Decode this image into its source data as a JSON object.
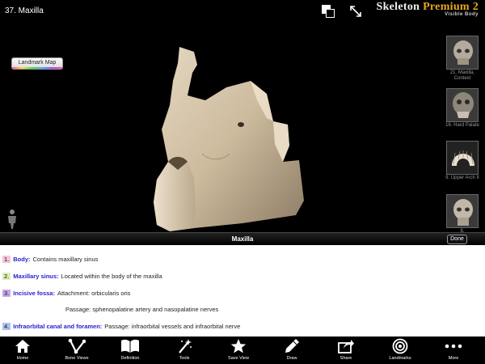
{
  "header": {
    "view_title": "37. Maxilla",
    "brand_word1": "Skeleton",
    "brand_word2": "Premium 2",
    "brand_sub": "Visible Body"
  },
  "viewport": {
    "landmark_map_label": "Landmark Map",
    "thumbnails": [
      {
        "label": "21. Maxilla, Context"
      },
      {
        "label": "16. Hard Palate"
      },
      {
        "label": "9. Upper Arch II"
      },
      {
        "label": "8."
      }
    ]
  },
  "info": {
    "title": "Maxilla",
    "done_label": "Done",
    "items": [
      {
        "num": "1.",
        "term": "Body:",
        "desc": "Contains maxillary sinus",
        "color": "#f6c6d9"
      },
      {
        "num": "2.",
        "term": "Maxillary sinus:",
        "desc": "Located within the body of the maxilla",
        "color": "#d9efb6"
      },
      {
        "num": "3.",
        "term": "Incisive fossa:",
        "desc": "Attachment: orbicularis oris",
        "color": "#c6a7e6"
      },
      {
        "num": "4.",
        "term": "Infraorbital canal and foramen:",
        "desc": "Passage: infraorbital vessels and infraorbital nerve",
        "color": "#a9c4ee"
      }
    ],
    "incisive_passage": "Passage: sphenopalatine artery and nasopalatine nerves"
  },
  "toolbar": {
    "items": [
      {
        "label": "Home",
        "icon": "home-icon"
      },
      {
        "label": "Bone Views",
        "icon": "bone-views-icon"
      },
      {
        "label": "Definition",
        "icon": "book-icon"
      },
      {
        "label": "Tools",
        "icon": "magic-wand-icon"
      },
      {
        "label": "Save View",
        "icon": "star-icon"
      },
      {
        "label": "Draw",
        "icon": "pencil-icon"
      },
      {
        "label": "Share",
        "icon": "share-icon"
      },
      {
        "label": "Landmarks",
        "icon": "target-icon"
      },
      {
        "label": "More",
        "icon": "more-dots-icon"
      }
    ]
  }
}
